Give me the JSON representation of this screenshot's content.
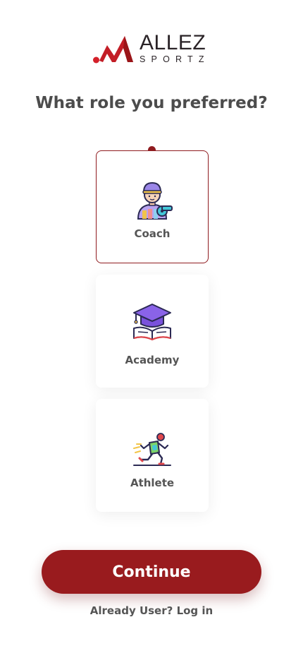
{
  "brand": {
    "name": "ALLEZ",
    "sub": "SPORTZ",
    "colors": {
      "primary": "#991b1e",
      "text": "#4c4c4c",
      "label": "#555555"
    }
  },
  "heading": "What role you preferred?",
  "roles": [
    {
      "label": "Coach",
      "icon": "coach-icon",
      "selected": true
    },
    {
      "label": "Academy",
      "icon": "graduation-cap-book-icon",
      "selected": false
    },
    {
      "label": "Athlete",
      "icon": "running-athlete-icon",
      "selected": false
    }
  ],
  "continue_label": "Continue",
  "login": {
    "prompt": "Already User?",
    "link": "Log in"
  }
}
